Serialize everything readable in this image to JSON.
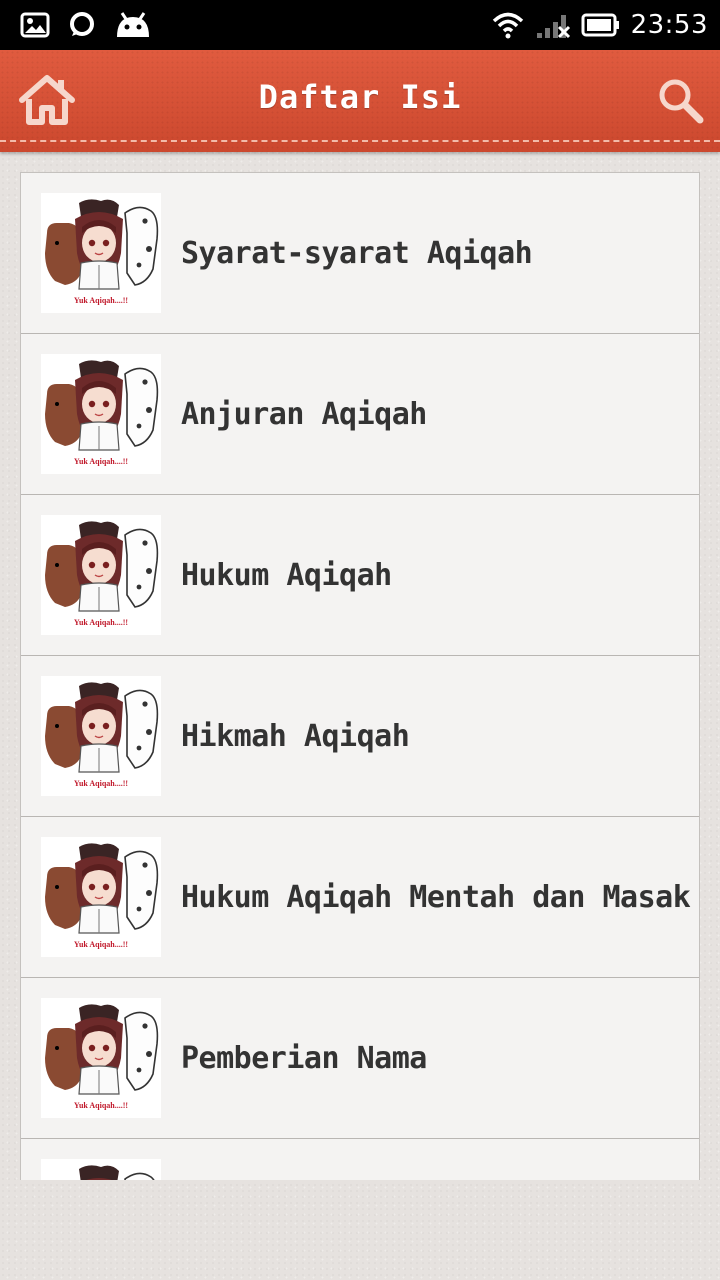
{
  "status_bar": {
    "time": "23:53",
    "icons": [
      "image-icon",
      "chat-bubble-icon",
      "android-icon",
      "wifi-icon",
      "signal-no-service-icon",
      "battery-icon"
    ]
  },
  "header": {
    "title": "Daftar Isi",
    "home_icon": "home-icon",
    "search_icon": "search-icon",
    "color": "#d6513a"
  },
  "list": {
    "thumbnail_caption": "Yuk Aqiqah....!!",
    "items": [
      {
        "label": "Syarat-syarat Aqiqah"
      },
      {
        "label": "Anjuran Aqiqah"
      },
      {
        "label": "Hukum Aqiqah"
      },
      {
        "label": "Hikmah Aqiqah"
      },
      {
        "label": "Hukum Aqiqah Mentah dan Masak"
      },
      {
        "label": "Pemberian Nama"
      },
      {
        "label": ""
      }
    ]
  }
}
